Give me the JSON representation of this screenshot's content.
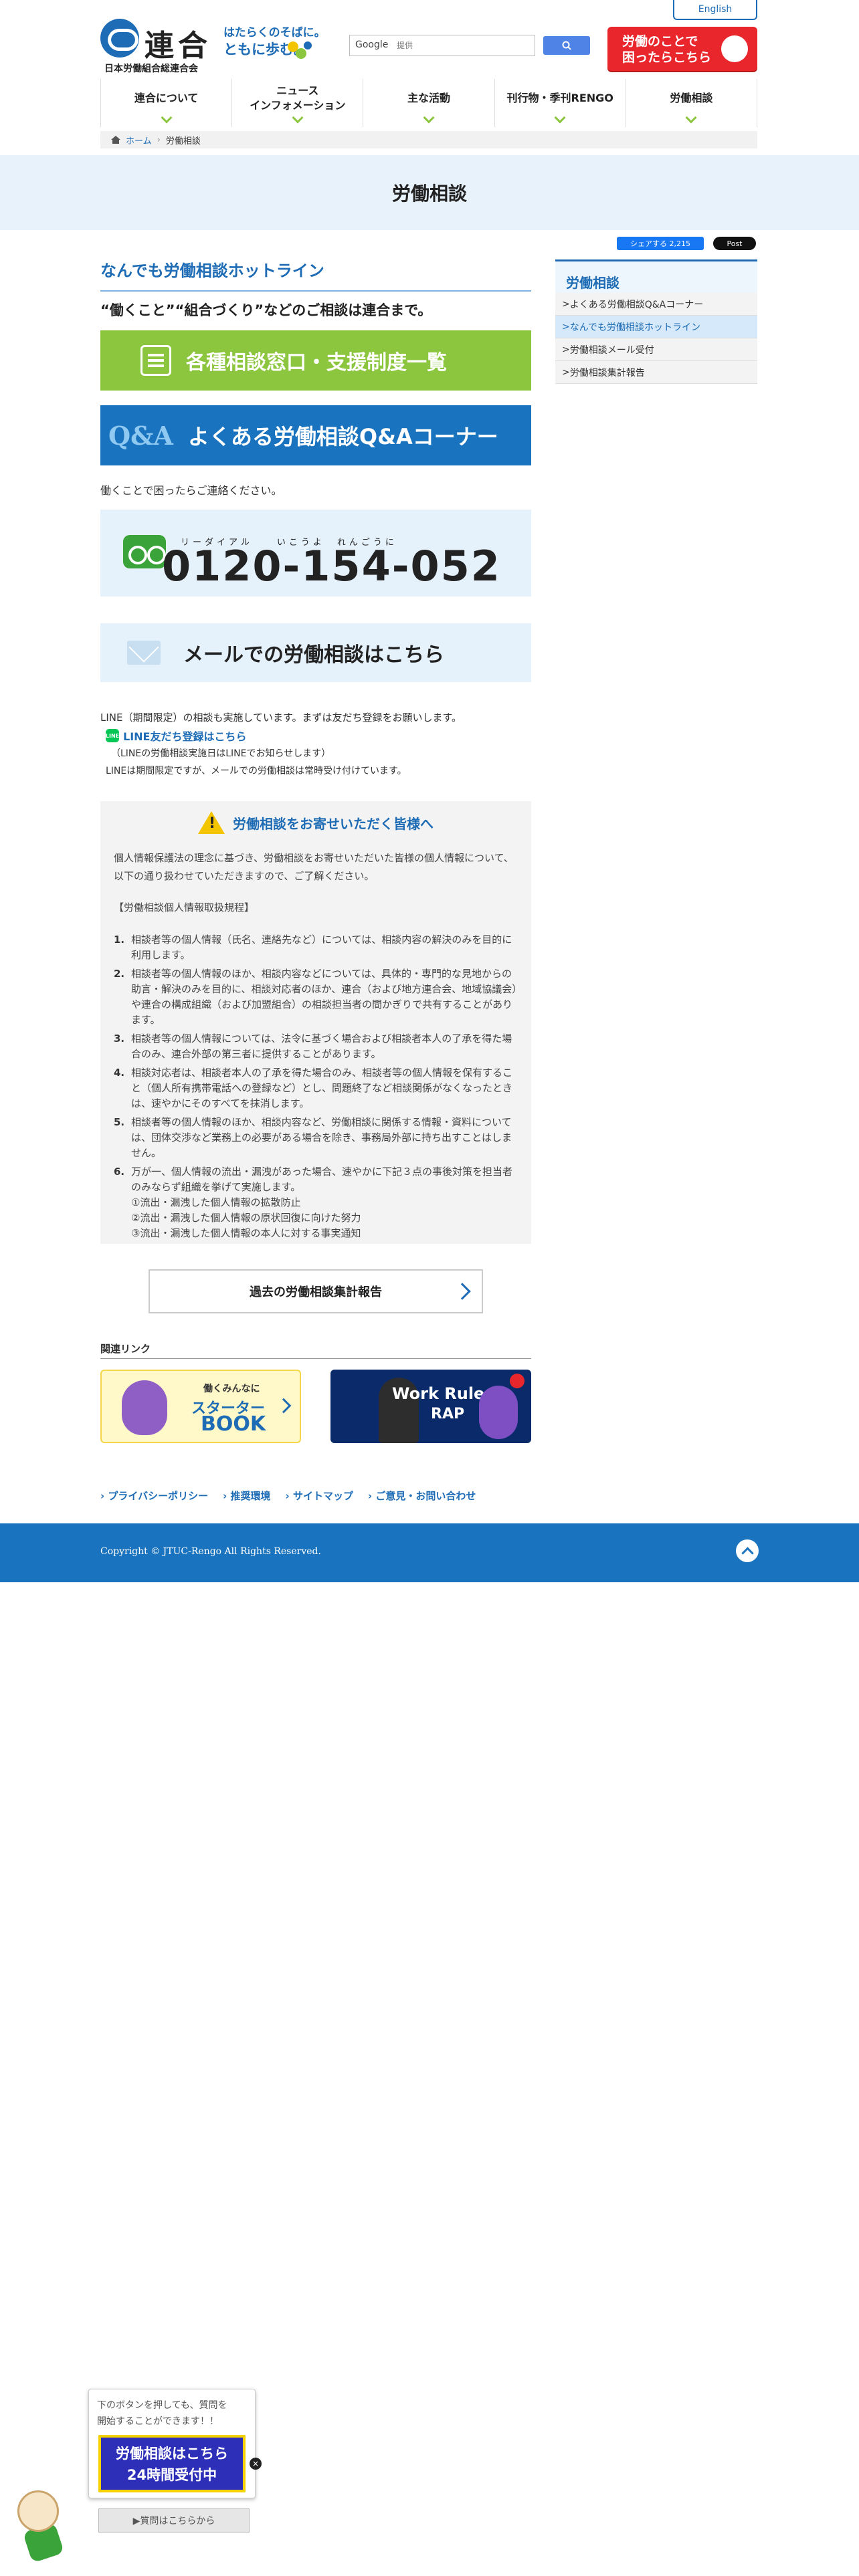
{
  "header": {
    "english": "English",
    "logo_name": "連合",
    "logo_sub": "日本労働組合総連合会",
    "slogan_line1": "はたらくのそばに。",
    "slogan_line2": "ともに歩む。",
    "search_provider": "Google",
    "search_placeholder": "提供",
    "consult_banner": "労働のことで\n困ったらこちら"
  },
  "nav": [
    {
      "label": "連合について"
    },
    {
      "label": "ニュース\nインフォメーション"
    },
    {
      "label": "主な活動"
    },
    {
      "label": "刊行物・季刊RENGO"
    },
    {
      "label": "労働相談"
    }
  ],
  "breadcrumb": {
    "home": "ホーム",
    "current": "労働相談"
  },
  "page_title": "労働相談",
  "share": {
    "facebook": "シェアする 2,215",
    "x": "Post"
  },
  "main": {
    "section_title": "なんでも労働相談ホットライン",
    "lead": "“働くこと”“組合づくり”などのご相談は連合まで。",
    "btn_green": "各種相談窓口・支援制度一覧",
    "btn_blue_icon": "Q&A",
    "btn_blue": "よくある労働相談Q&Aコーナー",
    "contact_text": "働くことで困ったらご連絡ください。",
    "phone_ruby": "リーダイアル　　いこうよ　れんごうに",
    "phone_number": "0120-154-052",
    "mail": "メールでの労働相談はこちら",
    "line_text": "LINE（期間限定）の相談も実施しています。まずは友だち登録をお願いします。",
    "line_link": "LINE友だち登録はこちら",
    "line_icon": "LINE",
    "line_note1": "（LINEの労働相談実施日はLINEでお知らせします）",
    "line_note2": "LINEは期間限定ですが、メールでの労働相談は常時受け付けています。"
  },
  "notice": {
    "title": "労働相談をお寄せいただく皆様へ",
    "intro": "個人情報保護法の理念に基づき、労働相談をお寄せいただいた皆様の個人情報について、以下の通り扱わせていただきますので、ご了解ください。",
    "rules_title": "【労働相談個人情報取扱規程】",
    "items": [
      {
        "num": "1.",
        "text": "相談者等の個人情報（氏名、連絡先など）については、相談内容の解決のみを目的に利用します。"
      },
      {
        "num": "2.",
        "text": "相談者等の個人情報のほか、相談内容などについては、具体的・専門的な見地からの助言・解決のみを目的に、相談対応者のほか、連合（および地方連合会、地域協議会）や連合の構成組織（および加盟組合）の相談担当者の間かぎりで共有することがあります。"
      },
      {
        "num": "3.",
        "text": "相談者等の個人情報については、法令に基づく場合および相談者本人の了承を得た場合のみ、連合外部の第三者に提供することがあります。"
      },
      {
        "num": "4.",
        "text": "相談対応者は、相談者本人の了承を得た場合のみ、相談者等の個人情報を保有すること（個人所有携帯電話への登録など）とし、問題終了など相談関係がなくなったときは、速やかにそのすべてを抹消します。"
      },
      {
        "num": "5.",
        "text": "相談者等の個人情報のほか、相談内容など、労働相談に関係する情報・資料については、団体交渉など業務上の必要がある場合を除き、事務局外部に持ち出すことはしません。"
      },
      {
        "num": "6.",
        "text": "万が一、個人情報の流出・漏洩があった場合、速やかに下記３点の事後対策を担当者のみならず組織を挙げて実施します。",
        "subs": [
          "①流出・漏洩した個人情報の拡散防止",
          "②流出・漏洩した個人情報の原状回復に向けた努力",
          "③流出・漏洩した個人情報の本人に対する事実通知"
        ]
      }
    ]
  },
  "report_button": "過去の労働相談集計報告",
  "related": {
    "title": "関連リンク",
    "starter_t1": "働くみんなに",
    "starter_t2": "スターター",
    "starter_t3": "BOOK",
    "rap_t1": "Work Rule",
    "rap_t2": "RAP"
  },
  "sidebar": {
    "title": "労働相談",
    "items": [
      {
        "label": "よくある労働相談Q&Aコーナー"
      },
      {
        "label": "なんでも労働相談ホットライン"
      },
      {
        "label": "労働相談メール受付"
      },
      {
        "label": "労働相談集計報告"
      }
    ]
  },
  "footer": {
    "links": [
      "プライバシーポリシー",
      "推奨環境",
      "サイトマップ",
      "ご意見・お問い合わせ"
    ],
    "copyright": "Copyright © JTUC-Rengo All Rights Reserved."
  },
  "chat": {
    "message": "下のボタンを押しても、質問を\n開始することができます！！",
    "button": "労働相談はこちら\n24時間受付中",
    "sub_button": "▶質問はこちらから",
    "close": "×"
  },
  "colors": {
    "primary": "#1e6cb5",
    "green": "#8cc63f",
    "red": "#e8262b",
    "light_blue": "#e5f1fb"
  }
}
